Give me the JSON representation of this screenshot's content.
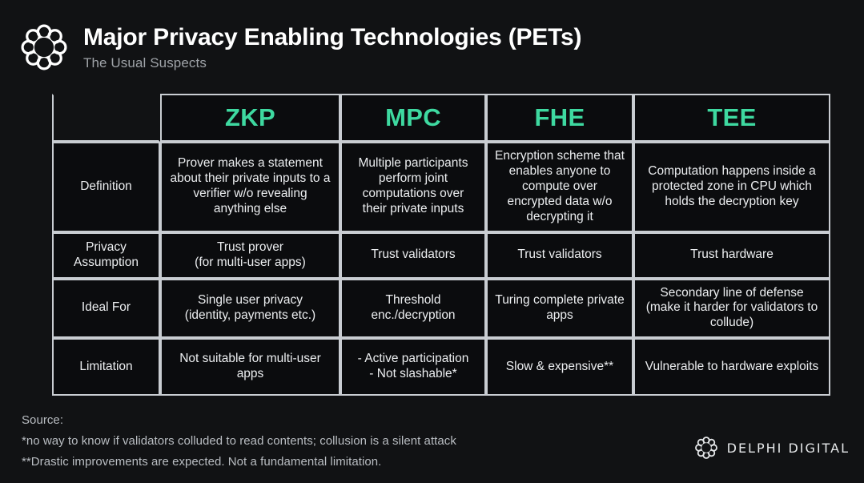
{
  "header": {
    "logo_icon": "delphi-ring-logo",
    "title": "Major Privacy Enabling Technologies (PETs)",
    "subtitle": "The Usual Suspects"
  },
  "colors": {
    "accent_green": "#3ED9A0",
    "background": "#111214",
    "cell_background": "#0B0C0E",
    "border": "#C9CDD2",
    "body_text": "#ECEEF0",
    "muted_text": "#B9BDC2"
  },
  "table": {
    "corner_label": "",
    "columns": [
      "ZKP",
      "MPC",
      "FHE",
      "TEE"
    ],
    "rows": [
      {
        "label": "Definition",
        "cells": [
          "Prover makes a statement about their private inputs to a verifier w/o revealing anything else",
          "Multiple participants perform joint computations over their private inputs",
          "Encryption scheme that enables anyone to compute over encrypted data w/o decrypting it",
          "Computation happens inside a protected zone in CPU which holds the decryption key"
        ]
      },
      {
        "label": "Privacy Assumption",
        "cells": [
          "Trust prover\n(for multi-user apps)",
          "Trust validators",
          "Trust validators",
          "Trust hardware"
        ]
      },
      {
        "label": "Ideal For",
        "cells": [
          "Single user privacy\n(identity, payments etc.)",
          "Threshold enc./decryption",
          "Turing complete private apps",
          "Secondary line of defense (make it harder for validators to collude)"
        ]
      },
      {
        "label": "Limitation",
        "cells": [
          "Not suitable for multi-user apps",
          "- Active participation\n- Not slashable*",
          "Slow & expensive**",
          "Vulnerable to hardware exploits"
        ]
      }
    ]
  },
  "footer": {
    "source_label": "Source:",
    "footnote_1": "*no way to know if validators colluded to read contents; collusion is a silent attack",
    "footnote_2": "**Drastic improvements are expected. Not a fundamental limitation.",
    "brand_icon": "delphi-ring-logo",
    "brand_name": "DELPHI DIGITAL"
  }
}
